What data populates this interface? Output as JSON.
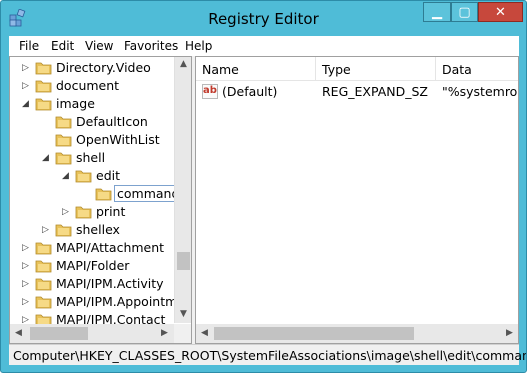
{
  "window": {
    "title": "Registry Editor"
  },
  "menu": [
    "File",
    "Edit",
    "View",
    "Favorites",
    "Help"
  ],
  "tree": {
    "items": [
      {
        "label": "Directory.Video",
        "twisty": "▷"
      },
      {
        "label": "document",
        "twisty": "▷"
      },
      {
        "label": "image",
        "twisty": "◢"
      },
      {
        "label": "DefaultIcon",
        "twisty": ""
      },
      {
        "label": "OpenWithList",
        "twisty": ""
      },
      {
        "label": "shell",
        "twisty": "◢"
      },
      {
        "label": "edit",
        "twisty": "◢"
      },
      {
        "label": "command",
        "twisty": ""
      },
      {
        "label": "print",
        "twisty": "▷"
      },
      {
        "label": "shellex",
        "twisty": "▷"
      },
      {
        "label": "MAPI/Attachment",
        "twisty": "▷"
      },
      {
        "label": "MAPI/Folder",
        "twisty": "▷"
      },
      {
        "label": "MAPI/IPM.Activity",
        "twisty": "▷"
      },
      {
        "label": "MAPI/IPM.Appointm",
        "twisty": "▷"
      },
      {
        "label": "MAPI/IPM.Contact",
        "twisty": "▷"
      }
    ]
  },
  "list": {
    "columns": [
      "Name",
      "Type",
      "Data"
    ],
    "rows": [
      {
        "name": "(Default)",
        "type": "REG_EXPAND_SZ",
        "data": "\"%systemroot%"
      }
    ]
  },
  "statusbar": {
    "path": "Computer\\HKEY_CLASSES_ROOT\\SystemFileAssociations\\image\\shell\\edit\\command"
  },
  "colors": {
    "frame": "#4fbcd7",
    "close": "#c7483c",
    "folder": "#e8c25a"
  }
}
